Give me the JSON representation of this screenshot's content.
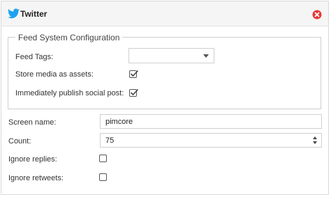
{
  "header": {
    "title": "Twitter"
  },
  "feed_config": {
    "legend": "Feed System Configuration",
    "feed_tags": {
      "label": "Feed Tags:",
      "value": ""
    },
    "store_media": {
      "label": "Store media as assets:",
      "checked": true
    },
    "publish": {
      "label": "Immediately publish social post:",
      "checked": true
    }
  },
  "fields": {
    "screen_name": {
      "label": "Screen name:",
      "value": "pimcore"
    },
    "count": {
      "label": "Count:",
      "value": "75"
    },
    "ignore_replies": {
      "label": "Ignore replies:",
      "checked": false
    },
    "ignore_retweets": {
      "label": "Ignore retweets:",
      "checked": false
    }
  },
  "colors": {
    "brand": "#1da1f2",
    "close": "#e53935"
  },
  "icons": {
    "header": "twitter-bird-icon",
    "close": "close-circle-icon"
  }
}
